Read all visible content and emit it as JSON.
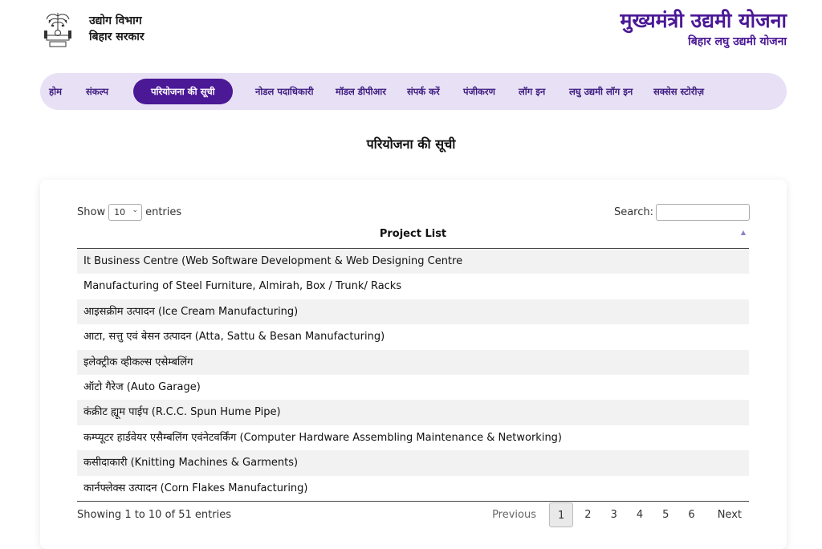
{
  "header": {
    "dept_line1": "उद्योग विभाग",
    "dept_line2": "बिहार सरकार",
    "scheme_title": "मुख्यमंत्री उद्यमी योजना",
    "scheme_subtitle": "बिहार लघु उद्यमी योजना"
  },
  "nav": {
    "items": [
      {
        "label": "होम"
      },
      {
        "label": "संकल्प"
      },
      {
        "label": "परियोजना की सूची"
      },
      {
        "label": "नोडल पदाधिकारी"
      },
      {
        "label": "मॉडल डीपीआर"
      },
      {
        "label": "संपर्क करें"
      },
      {
        "label": "पंजीकरण"
      },
      {
        "label": "लॉग इन"
      },
      {
        "label": "लघु उद्यमी लॉग इन"
      },
      {
        "label": "सक्सेस स्टोरीज़"
      }
    ],
    "active_index": 2
  },
  "page_title": "परियोजना की सूची",
  "table": {
    "length_prefix": "Show",
    "length_value": "10",
    "length_suffix": "entries",
    "search_label": "Search:",
    "search_value": "",
    "column_header": "Project List",
    "rows": [
      "It Business Centre (Web Software Development & Web Designing Centre",
      "Manufacturing of Steel Furniture, Almirah, Box / Trunk/ Racks",
      "आइसक्रीम उत्पादन (Ice Cream Manufacturing)",
      "आटा, सत्तु एवं बेसन उत्पादन (Atta, Sattu & Besan Manufacturing)",
      "इलेक्ट्रीक व्हीकल्स एसेम्बलिंग",
      "ऑटो गैरेज (Auto Garage)",
      "कंक्रीट ह्यूम पाईप (R.C.C. Spun Hume Pipe)",
      "कम्प्यूटर हार्डवेयर एसैम्बलिंग एवंनेटवर्किंग (Computer Hardware Assembling Maintenance & Networking)",
      "कसीदाकारी (Knitting Machines & Garments)",
      "कार्नफ्लेक्स उत्पादन (Corn Flakes Manufacturing)"
    ],
    "info": "Showing 1 to 10 of 51 entries",
    "pagination": {
      "previous": "Previous",
      "pages": [
        "1",
        "2",
        "3",
        "4",
        "5",
        "6"
      ],
      "current": "1",
      "next": "Next"
    }
  },
  "colors": {
    "brand_purple": "#4b1896",
    "nav_background": "#e8e1f5"
  },
  "icons": {
    "emblem": "bihar-emblem-icon",
    "sort": "sort-ascending-icon",
    "select_chevron": "chevron-down-icon"
  }
}
